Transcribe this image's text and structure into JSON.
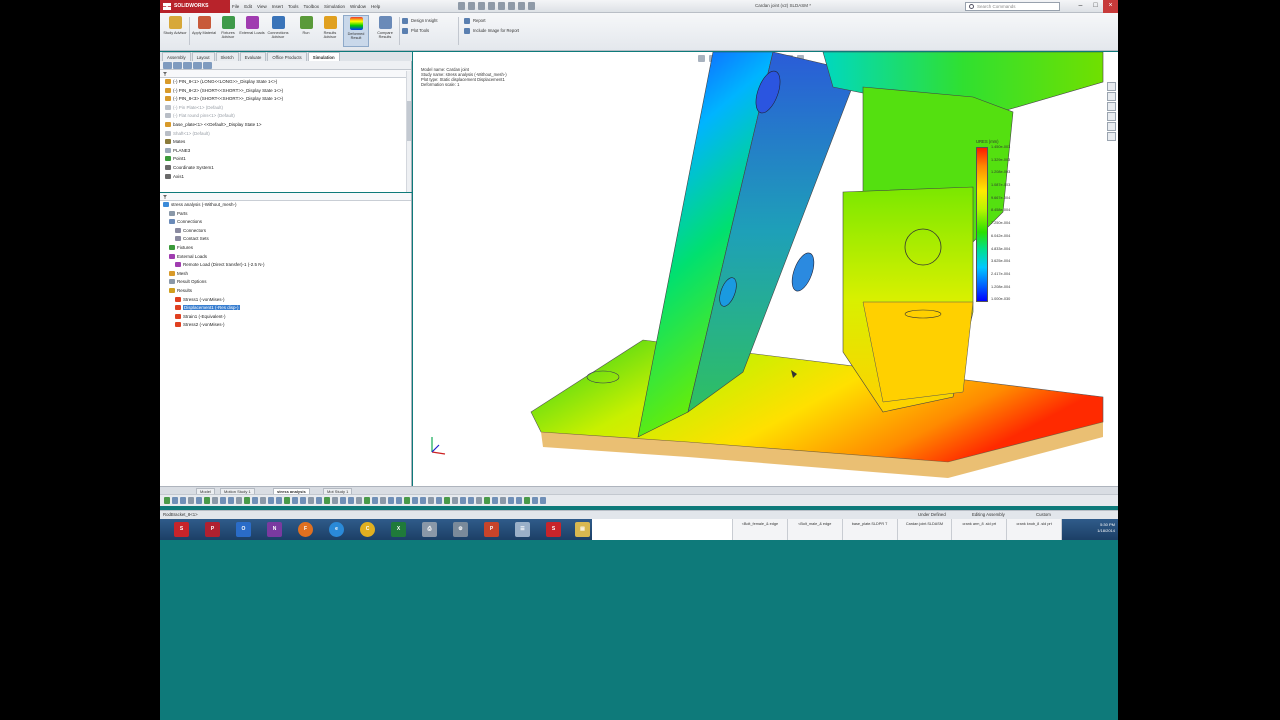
{
  "app": {
    "logo_text": "SOLIDWORKS",
    "doc_title": "Cardan joint (v2) SLDASM *",
    "search_placeholder": "Search Commands",
    "menu": [
      "File",
      "Edit",
      "View",
      "Insert",
      "Tools",
      "Toolbox",
      "Simulation",
      "Window",
      "Help"
    ]
  },
  "ribbon": {
    "buttons": [
      {
        "label": "Study Advisor"
      },
      {
        "label": "Apply Material"
      },
      {
        "label": "Fixtures Advisor"
      },
      {
        "label": "External Loads"
      },
      {
        "label": "Connections Advisor"
      },
      {
        "label": "Run"
      },
      {
        "label": "Results Advisor"
      },
      {
        "label": "Deformed Result"
      },
      {
        "label": "Compare Results"
      }
    ],
    "small": [
      "Design Insight",
      "Plot Tools",
      "Report",
      "Include Image for Report"
    ]
  },
  "cm_tabs": [
    "Assembly",
    "Layout",
    "Sketch",
    "Evaluate",
    "Office Products",
    "Simulation"
  ],
  "feature_tree": [
    {
      "label": "(-) PIN_8<1> (LONG<<LONG>>_Display State 1<>)",
      "dim": false
    },
    {
      "label": "(-) PIN_8<2> (SHORT<<SHORT>>_Display State 1<>)",
      "dim": false
    },
    {
      "label": "(-) PIN_8<3> (SHORT<<SHORT>>_Display State 1<>)",
      "dim": false
    },
    {
      "label": "(-) Pin Plate<1> (Default)",
      "dim": true
    },
    {
      "label": "(-) Flat round pins<1> (Default)",
      "dim": true
    },
    {
      "label": "base_plate<1> <<Default>_Display State 1>",
      "dim": false
    },
    {
      "label": "Shaft<1> (Default)",
      "dim": true
    },
    {
      "label": "Mates",
      "dim": false
    },
    {
      "label": "PLANE3",
      "dim": false
    },
    {
      "label": "Point1",
      "dim": false
    },
    {
      "label": "Coordinate System1",
      "dim": false
    },
    {
      "label": "Axis1",
      "dim": false
    }
  ],
  "sim_tree": [
    {
      "label": "stress analysis (-Without_mesh-)",
      "indent": 0,
      "selected": false
    },
    {
      "label": "Parts",
      "indent": 1,
      "selected": false
    },
    {
      "label": "Connections",
      "indent": 1,
      "selected": false
    },
    {
      "label": "Connectors",
      "indent": 2,
      "selected": false
    },
    {
      "label": "Contact Sets",
      "indent": 2,
      "selected": false
    },
    {
      "label": "Fixtures",
      "indent": 1,
      "selected": false
    },
    {
      "label": "External Loads",
      "indent": 1,
      "selected": false
    },
    {
      "label": "Remote Load (Direct transfer)-1 (-2.5 N-)",
      "indent": 2,
      "selected": false
    },
    {
      "label": "Mesh",
      "indent": 1,
      "selected": false
    },
    {
      "label": "Result Options",
      "indent": 1,
      "selected": false
    },
    {
      "label": "Results",
      "indent": 1,
      "selected": false
    },
    {
      "label": "Stress1 (-vonMises-)",
      "indent": 2,
      "selected": false
    },
    {
      "label": "Displacement1 (-Res disp-)",
      "indent": 2,
      "selected": true
    },
    {
      "label": "Strain1 (-Equivalent-)",
      "indent": 2,
      "selected": false
    },
    {
      "label": "Stress2 (-vonMises-)",
      "indent": 2,
      "selected": false
    }
  ],
  "viewport": {
    "info": [
      "Model name: Cardan joint",
      "Study name: stress analysis (-Without_mesh-)",
      "Plot type: Static displacement Displacement1",
      "Deformation scale: 1"
    ],
    "legend_title": "URES (mm)",
    "legend_ticks": [
      "1.450e-003",
      "1.329e-003",
      "1.208e-003",
      "1.087e-003",
      "9.667e-004",
      "8.458e-004",
      "7.250e-004",
      "6.042e-004",
      "4.833e-004",
      "3.625e-004",
      "2.417e-004",
      "1.208e-004",
      "1.000e-030"
    ]
  },
  "sheet_tabs": [
    "Model",
    "Motion Study 1",
    "stress analysis",
    "Mot Study 1"
  ],
  "status": {
    "left": "RodBracket_8<1>",
    "state": "Under Defined",
    "mode": "Editing Assembly",
    "units": "Custom"
  },
  "taskbar": {
    "tasks": [
      "<Bolt_female_& edge",
      "<Bolt_male_& edge",
      "base_plate.SLDPR T",
      "Cardan joint.SLDASM",
      "crank arm_8 .sld prt",
      "crank knob_8 .sld prt"
    ],
    "time": "5:30 PM",
    "date": "1/18/2014"
  },
  "colors": {
    "accent_red": "#b8232b",
    "selection_blue": "#3a7fd0",
    "desktop_teal": "#0e7a7a"
  }
}
